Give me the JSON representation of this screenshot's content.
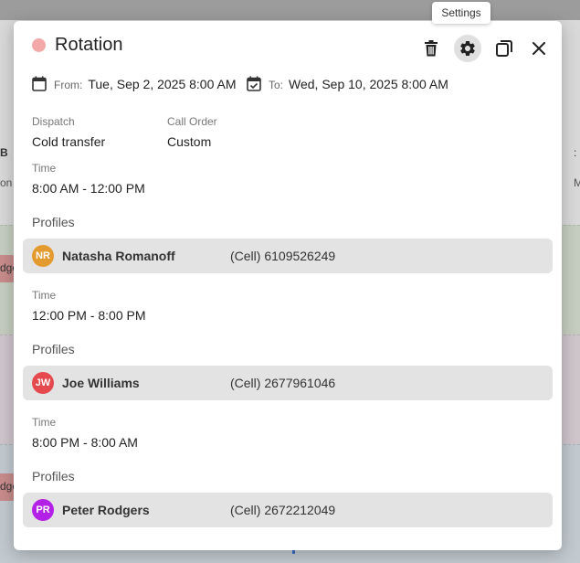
{
  "background": {
    "fragments": [
      "B",
      "on",
      "dge",
      "dge",
      "M"
    ]
  },
  "tooltip": {
    "text": "Settings"
  },
  "dialog": {
    "title": "Rotation",
    "status_color": "#f4a9a9",
    "from": {
      "label": "From:",
      "value": "Tue, Sep 2, 2025 8:00 AM"
    },
    "to": {
      "label": "To:",
      "value": "Wed, Sep 10, 2025 8:00 AM"
    },
    "dispatch": {
      "label": "Dispatch",
      "value": "Cold transfer"
    },
    "call_order": {
      "label": "Call Order",
      "value": "Custom"
    },
    "shifts": [
      {
        "time_label": "Time",
        "time_value": "8:00 AM - 12:00 PM",
        "profiles_label": "Profiles",
        "profile": {
          "initials": "NR",
          "color": "#e39a2e",
          "name": "Natasha Romanoff",
          "phone": "(Cell) 6109526249"
        }
      },
      {
        "time_label": "Time",
        "time_value": "12:00 PM - 8:00 PM",
        "profiles_label": "Profiles",
        "profile": {
          "initials": "JW",
          "color": "#e5484d",
          "name": "Joe Williams",
          "phone": "(Cell) 2677961046"
        }
      },
      {
        "time_label": "Time",
        "time_value": "8:00 PM - 8:00 AM",
        "profiles_label": "Profiles",
        "profile": {
          "initials": "PR",
          "color": "#b321e6",
          "name": "Peter Rodgers",
          "phone": "(Cell) 2672212049"
        }
      }
    ],
    "icons": {
      "delete": "trash-icon",
      "settings": "gear-icon",
      "duplicate": "copy-icon",
      "close": "close-icon",
      "from": "calendar-icon",
      "to": "calendar-check-icon"
    }
  }
}
